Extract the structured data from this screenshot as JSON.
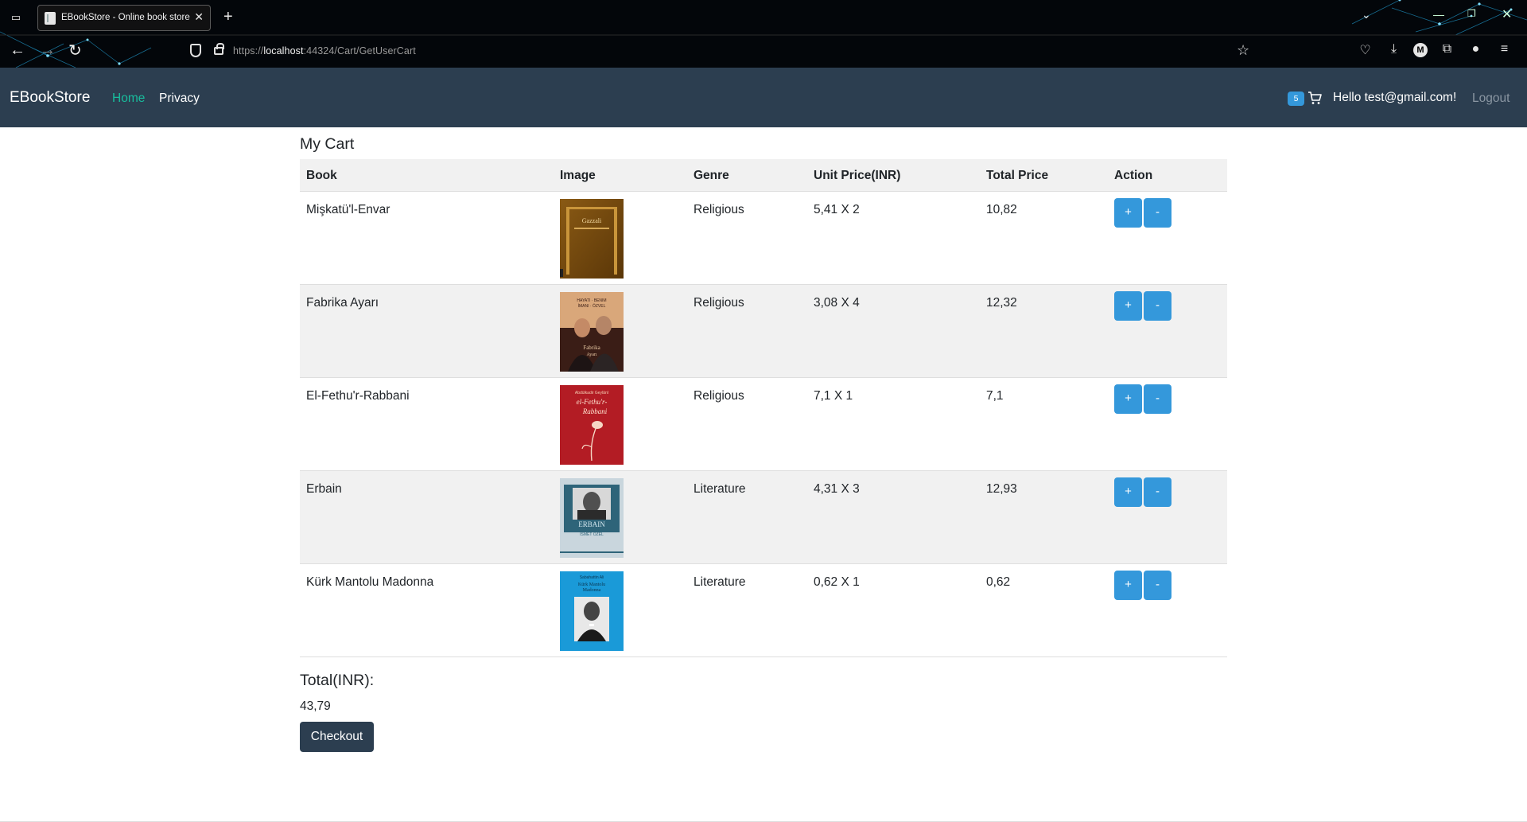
{
  "browser": {
    "tab_title": "EBookStore - Online book store",
    "tab_close": "✕",
    "new_tab": "+",
    "url_prefix": "https://",
    "url_host": "localhost",
    "url_rest": ":44324/Cart/GetUserCart"
  },
  "navbar": {
    "brand": "EBookStore",
    "home": "Home",
    "privacy": "Privacy",
    "cart_count": "5",
    "greeting": "Hello test@gmail.com!",
    "logout": "Logout",
    "home_color": "#18bc9c",
    "bg_color": "#2c3e50"
  },
  "cart": {
    "title": "My Cart",
    "columns": [
      "Book",
      "Image",
      "Genre",
      "Unit Price(INR)",
      "Total Price",
      "Action"
    ],
    "rows": [
      {
        "book": "Mişkatü'l-Envar",
        "genre": "Religious",
        "unit": "5,41 X 2",
        "total": "10,82",
        "plus": "+",
        "minus": "-",
        "cover_texts": [
          "Gazzali"
        ]
      },
      {
        "book": "Fabrika Ayarı",
        "genre": "Religious",
        "unit": "3,08 X 4",
        "total": "12,32",
        "plus": "+",
        "minus": "-",
        "cover_texts": [
          "HAYATI · BENIM",
          "İMANI · ÖZVEL",
          "Fabrika",
          "Ayarı"
        ]
      },
      {
        "book": "El-Fethu'r-Rabbani",
        "genre": "Religious",
        "unit": "7,1 X 1",
        "total": "7,1",
        "plus": "+",
        "minus": "-",
        "cover_texts": [
          "Abdülkadir Geylânî",
          "el-Fethu'r-",
          "Rabbani"
        ]
      },
      {
        "book": "Erbain",
        "genre": "Literature",
        "unit": "4,31 X 3",
        "total": "12,93",
        "plus": "+",
        "minus": "-",
        "cover_texts": [
          "ERBAIN",
          "İSMET ÖZEL"
        ]
      },
      {
        "book": "Kürk Mantolu Madonna",
        "genre": "Literature",
        "unit": "0,62 X 1",
        "total": "0,62",
        "plus": "+",
        "minus": "-",
        "cover_texts": [
          "Sabahattin Ali",
          "Kürk Mantolu",
          "Madonna"
        ]
      }
    ],
    "total_label": "Total(INR):",
    "total_value": "43,79",
    "checkout": "Checkout"
  }
}
